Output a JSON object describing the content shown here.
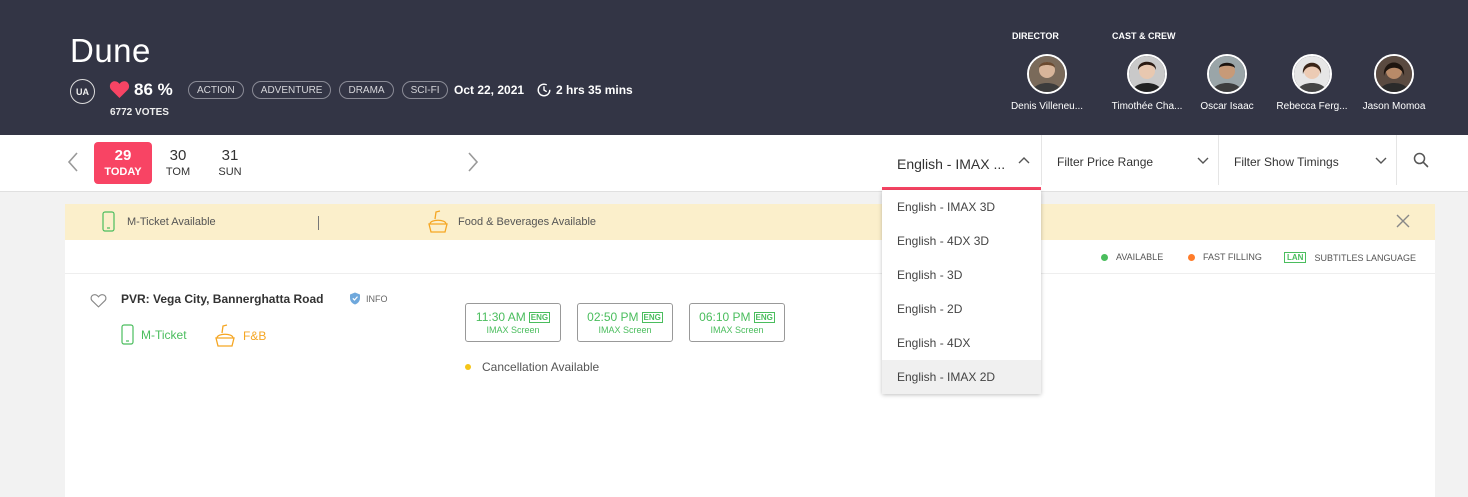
{
  "movie": {
    "title": "Dune",
    "certificate": "UA",
    "rating": "86 %",
    "votes": "6772 VOTES",
    "genres": [
      "ACTION",
      "ADVENTURE",
      "DRAMA",
      "SCI-FI"
    ],
    "release_date": "Oct 22, 2021",
    "duration": "2 hrs 35 mins"
  },
  "crew": {
    "director_label": "DIRECTOR",
    "cast_label": "CAST & CREW",
    "people": [
      {
        "name": "Denis Villeneu..."
      },
      {
        "name": "Timothée Cha..."
      },
      {
        "name": "Oscar Isaac"
      },
      {
        "name": "Rebecca Ferg..."
      },
      {
        "name": "Jason Momoa"
      }
    ]
  },
  "dates": [
    {
      "day": "29",
      "label": "TODAY",
      "selected": true
    },
    {
      "day": "30",
      "label": "TOM",
      "selected": false
    },
    {
      "day": "31",
      "label": "SUN",
      "selected": false
    }
  ],
  "filters": {
    "language_selected": "English - IMAX ...",
    "price": "Filter Price Range",
    "timings": "Filter Show Timings"
  },
  "language_options": [
    "English - IMAX 3D",
    "English - 4DX 3D",
    "English - 3D",
    "English - 2D",
    "English - 4DX",
    "English - IMAX 2D"
  ],
  "banner": {
    "mticket": "M-Ticket Available",
    "food": "Food & Beverages Available"
  },
  "legend": {
    "available": "AVAILABLE",
    "fast_filling": "FAST FILLING",
    "lan_badge": "LAN",
    "subtitles": "SUBTITLES LANGUAGE"
  },
  "venue": {
    "name": "PVR: Vega City, Bannerghatta Road",
    "info": "INFO",
    "mticket": "M-Ticket",
    "fnb": "F&B",
    "cancellation": "Cancellation Available",
    "shows": [
      {
        "time": "11:30 AM",
        "lang": "ENG",
        "screen": "IMAX Screen"
      },
      {
        "time": "02:50 PM",
        "lang": "ENG",
        "screen": "IMAX Screen"
      },
      {
        "time": "06:10 PM",
        "lang": "ENG",
        "screen": "IMAX Screen"
      }
    ]
  },
  "colors": {
    "header_bg": "#333545",
    "accent": "#f84464",
    "available_green": "#4abd5d",
    "fast_filling": "#ff7c2a",
    "banner_bg": "#fbefcb"
  }
}
